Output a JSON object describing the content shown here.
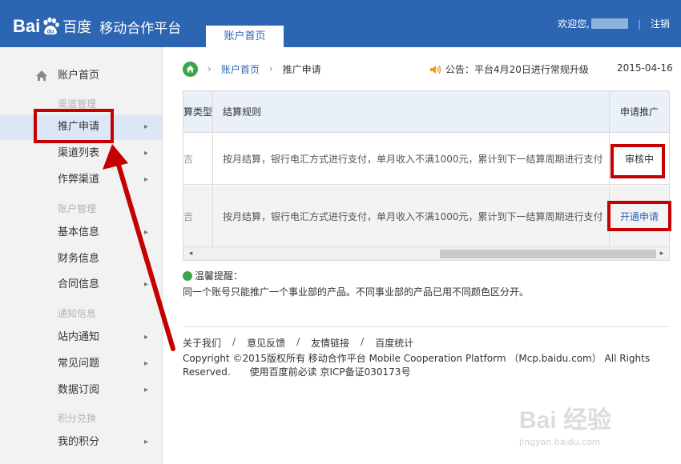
{
  "header": {
    "logo_bai": "Bai",
    "logo_du": "du",
    "logo_cn": "百度",
    "subtitle": "移动合作平台",
    "tab": "账户首页",
    "welcome": "欢迎您,",
    "logout": "注销",
    "separator": "|"
  },
  "sidebar": {
    "home": "账户首页",
    "groups": [
      "渠道管理",
      "账户管理",
      "通知信息",
      "积分兑换"
    ],
    "items": [
      {
        "label": "推广申请",
        "arrow": "▸"
      },
      {
        "label": "渠道列表",
        "arrow": "▸"
      },
      {
        "label": "作弊渠道",
        "arrow": "▸"
      },
      {
        "label": "基本信息",
        "arrow": "▸"
      },
      {
        "label": "财务信息",
        "arrow": "▸"
      },
      {
        "label": "合同信息",
        "arrow": "▸"
      },
      {
        "label": "站内通知",
        "arrow": "▸"
      },
      {
        "label": "常见问题",
        "arrow": "▸"
      },
      {
        "label": "数据订阅",
        "arrow": "▸"
      },
      {
        "label": "我的积分",
        "arrow": "▸"
      }
    ]
  },
  "breadcrumb": {
    "gt": "›",
    "level1": "账户首页",
    "level2": "推广申请"
  },
  "notice": "公告：平台4月20日进行常规升级",
  "date": "2015-04-16",
  "table": {
    "headers": [
      "算类型",
      "结算规则",
      "申请推广"
    ],
    "rows": [
      {
        "c1": "吉",
        "rule": "按月结算，银行电汇方式进行支付，单月收入不满1000元，累计到下一结算周期进行支付",
        "action": "审核中"
      },
      {
        "c1": "吉",
        "rule": "按月结算，银行电汇方式进行支付，单月收入不满1000元，累计到下一结算周期进行支付",
        "action": "开通申请"
      }
    ],
    "scroll_left": "◂",
    "scroll_right": "▸"
  },
  "tip": {
    "title": "温馨提醒：",
    "body": "同一个账号只能推广一个事业部的产品。不同事业部的产品已用不同颜色区分开。"
  },
  "footer": {
    "links": [
      "关于我们",
      "意见反馈",
      "友情链接",
      "百度统计"
    ],
    "slash": "/",
    "copyright": "Copyright ©2015版权所有 移动合作平台 Mobile Cooperation Platform （Mcp.baidu.com） All Rights Reserved.　　使用百度前必读 京ICP备证030173号"
  },
  "watermark": {
    "logo": "Bai  经验",
    "url": "jingyan.baidu.com"
  },
  "colors": {
    "header_blue": "#2c66b3",
    "annotation_red": "#c40000",
    "sidebar_bg": "#f2f2f2",
    "active_bg": "#dbe7f6"
  }
}
